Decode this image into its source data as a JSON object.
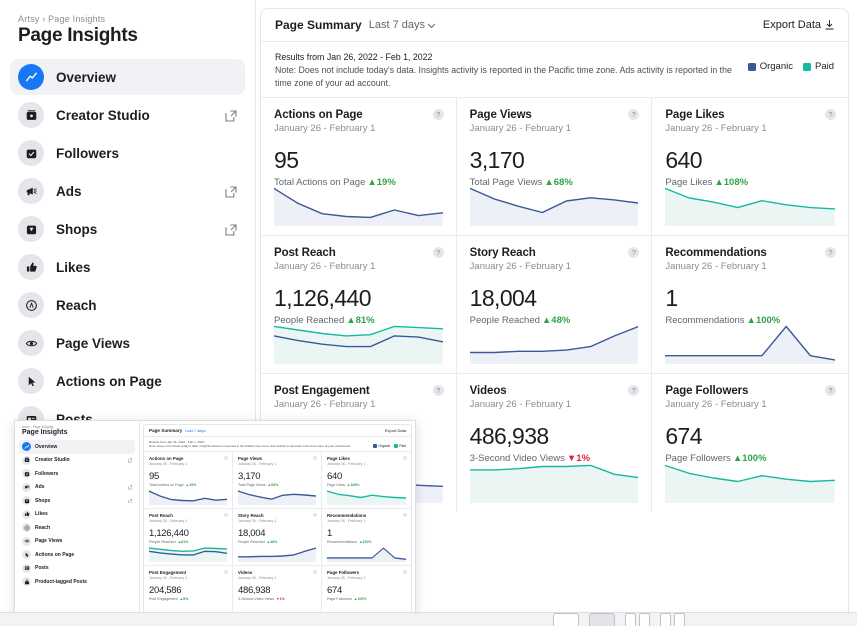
{
  "sidebar": {
    "breadcrumb": "Artsy › Page Insights",
    "title": "Page Insights",
    "items": [
      {
        "label": "Overview",
        "icon": "chart-line-icon",
        "active": true,
        "external": false
      },
      {
        "label": "Creator Studio",
        "icon": "creator-studio-icon",
        "active": false,
        "external": true
      },
      {
        "label": "Followers",
        "icon": "followers-icon",
        "active": false,
        "external": false
      },
      {
        "label": "Ads",
        "icon": "megaphone-icon",
        "active": false,
        "external": true
      },
      {
        "label": "Shops",
        "icon": "shops-icon",
        "active": false,
        "external": true
      },
      {
        "label": "Likes",
        "icon": "thumbs-up-icon",
        "active": false,
        "external": false
      },
      {
        "label": "Reach",
        "icon": "reach-icon",
        "active": false,
        "external": false
      },
      {
        "label": "Page Views",
        "icon": "eye-icon",
        "active": false,
        "external": false
      },
      {
        "label": "Actions on Page",
        "icon": "cursor-icon",
        "active": false,
        "external": false
      },
      {
        "label": "Posts",
        "icon": "posts-icon",
        "active": false,
        "external": false
      },
      {
        "label": "Product-tagged Posts",
        "icon": "bag-icon",
        "active": false,
        "external": false
      }
    ]
  },
  "panel": {
    "title": "Page Summary",
    "range": "Last 7 days",
    "range_caret": "chevron-down-icon",
    "export_label": "Export Data",
    "export_icon": "download-icon",
    "note_line1": "Results from Jan 26, 2022 - Feb 1, 2022",
    "note_line2": "Note: Does not include today's data. Insights activity is reported in the Pacific time zone. Ads activity is reported in the time zone of your ad account.",
    "legend": [
      {
        "label": "Organic",
        "color": "#3b5998"
      },
      {
        "label": "Paid",
        "color": "#16b9a0"
      }
    ]
  },
  "colors": {
    "organic": "#3b5998",
    "paid": "#16b9a0",
    "organic_fill": "#eaedf6",
    "paid_fill": "#e8f5f2",
    "up": "#31a24c",
    "down": "#e41e3f",
    "accent": "#1877f2"
  },
  "cards": [
    {
      "title": "Actions on Page",
      "range": "January 26 - February 1",
      "value": "95",
      "metric": "Total Actions on Page",
      "delta": "▲19%",
      "dir": "up",
      "info": "?"
    },
    {
      "title": "Page Views",
      "range": "January 26 - February 1",
      "value": "3,170",
      "metric": "Total Page Views",
      "delta": "▲68%",
      "dir": "up",
      "info": "?"
    },
    {
      "title": "Page Likes",
      "range": "January 26 - February 1",
      "value": "640",
      "metric": "Page Likes",
      "delta": "▲108%",
      "dir": "up",
      "info": "?"
    },
    {
      "title": "Post Reach",
      "range": "January 26 - February 1",
      "value": "1,126,440",
      "metric": "People Reached",
      "delta": "▲81%",
      "dir": "up",
      "info": "?"
    },
    {
      "title": "Story Reach",
      "range": "January 26 - February 1",
      "value": "18,004",
      "metric": "People Reached",
      "delta": "▲48%",
      "dir": "up",
      "info": "?"
    },
    {
      "title": "Recommendations",
      "range": "January 26 - February 1",
      "value": "1",
      "metric": "Recommendations",
      "delta": "▲100%",
      "dir": "up",
      "info": "?"
    },
    {
      "title": "Post Engagement",
      "range": "January 26 - February 1",
      "value": "204,586",
      "metric": "Post Engagement",
      "delta": "▲8%",
      "dir": "up",
      "info": "?"
    },
    {
      "title": "Videos",
      "range": "January 26 - February 1",
      "value": "486,938",
      "metric": "3-Second Video Views",
      "delta": "▼1%",
      "dir": "down",
      "info": "?"
    },
    {
      "title": "Page Followers",
      "range": "January 26 - February 1",
      "value": "674",
      "metric": "Page Followers",
      "delta": "▲100%",
      "dir": "up",
      "info": "?"
    }
  ],
  "chart_data": [
    {
      "type": "area",
      "title": "Actions on Page",
      "x": [
        1,
        2,
        3,
        4,
        5,
        6,
        7
      ],
      "series": [
        {
          "name": "Organic",
          "color": "#3b5998",
          "values": [
            38,
            22,
            11,
            8,
            7,
            15,
            9,
            12
          ]
        }
      ],
      "ylabel": "",
      "xlabel": "",
      "grid": false
    },
    {
      "type": "area",
      "title": "Page Views",
      "x": [
        1,
        2,
        3,
        4,
        5,
        6,
        7
      ],
      "series": [
        {
          "name": "Organic",
          "color": "#3b5998",
          "values": [
            34,
            24,
            17,
            11,
            22,
            25,
            23,
            20
          ]
        }
      ],
      "ylabel": "",
      "xlabel": "",
      "grid": false
    },
    {
      "type": "area",
      "title": "Page Likes",
      "x": [
        1,
        2,
        3,
        4,
        5,
        6,
        7
      ],
      "series": [
        {
          "name": "Paid",
          "color": "#16b9a0",
          "values": [
            26,
            19,
            16,
            12,
            17,
            14,
            12,
            11
          ]
        }
      ],
      "ylabel": "",
      "xlabel": "",
      "grid": false
    },
    {
      "type": "area",
      "title": "Post Reach",
      "x": [
        1,
        2,
        3,
        4,
        5,
        6,
        7
      ],
      "series": [
        {
          "name": "Paid",
          "color": "#16b9a0",
          "values": [
            30,
            27,
            24,
            22,
            23,
            30,
            29,
            28
          ]
        },
        {
          "name": "Organic",
          "color": "#3b5998",
          "values": [
            22,
            18,
            15,
            13,
            13,
            22,
            21,
            17
          ]
        }
      ],
      "ylabel": "",
      "xlabel": "",
      "grid": false
    },
    {
      "type": "area",
      "title": "Story Reach",
      "x": [
        1,
        2,
        3,
        4,
        5,
        6,
        7
      ],
      "series": [
        {
          "name": "Organic",
          "color": "#3b5998",
          "values": [
            8,
            8,
            9,
            9,
            10,
            13,
            22,
            30
          ]
        }
      ],
      "ylabel": "",
      "xlabel": "",
      "grid": false
    },
    {
      "type": "area",
      "title": "Recommendations",
      "x": [
        1,
        2,
        3,
        4,
        5,
        6,
        7
      ],
      "series": [
        {
          "name": "Organic",
          "color": "#3b5998",
          "values": [
            6,
            6,
            6,
            6,
            6,
            34,
            6,
            2
          ]
        }
      ],
      "ylabel": "",
      "xlabel": "",
      "grid": false
    },
    {
      "type": "area",
      "title": "Post Engagement",
      "x": [
        1,
        2,
        3,
        4,
        5,
        6,
        7
      ],
      "series": [
        {
          "name": "Organic",
          "color": "#3b5998",
          "values": [
            34,
            24,
            16,
            12,
            13,
            18,
            15,
            14
          ]
        }
      ],
      "ylabel": "",
      "xlabel": "",
      "grid": false
    },
    {
      "type": "area",
      "title": "Videos",
      "x": [
        1,
        2,
        3,
        4,
        5,
        6,
        7
      ],
      "series": [
        {
          "name": "Paid",
          "color": "#16b9a0",
          "values": [
            28,
            28,
            29,
            31,
            31,
            32,
            24,
            21
          ]
        }
      ],
      "ylabel": "",
      "xlabel": "",
      "grid": false
    },
    {
      "type": "area",
      "title": "Page Followers",
      "x": [
        1,
        2,
        3,
        4,
        5,
        6,
        7
      ],
      "series": [
        {
          "name": "Paid",
          "color": "#16b9a0",
          "values": [
            31,
            24,
            20,
            17,
            22,
            19,
            17,
            18
          ]
        }
      ],
      "ylabel": "",
      "xlabel": "",
      "grid": false
    }
  ],
  "mini_window": {
    "visible": true,
    "is_duplicate_of_main": true
  },
  "taskbar": {
    "items": [
      "window-thumb-1",
      "window-thumb-2-selected",
      "window-thumb-pair-1",
      "window-thumb-pair-2"
    ]
  }
}
